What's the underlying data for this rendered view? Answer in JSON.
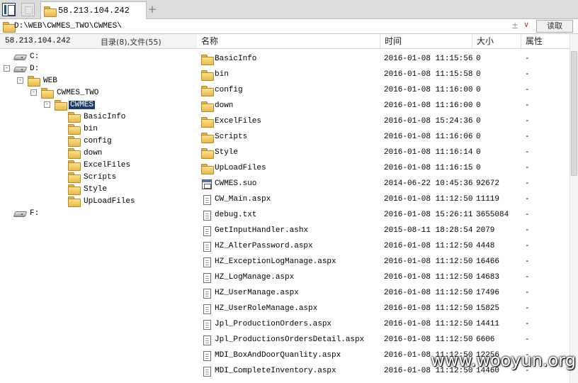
{
  "tab": {
    "title": "58.213.104.242",
    "add_label": "+"
  },
  "address": {
    "path": "D:\\WEB\\CWMES_TWO\\CWMES\\",
    "plus": "±",
    "dropdown": "∨",
    "read_button": "读取"
  },
  "left_header": {
    "host": "58.213.104.242",
    "summary": "目录(8),文件(55)"
  },
  "tree": {
    "drive_c": "C:",
    "drive_d": "D:",
    "web": "WEB",
    "cwmes_two": "CWMES_TWO",
    "cwmes": "CWMES",
    "children": [
      "BasicInfo",
      "bin",
      "config",
      "down",
      "ExcelFiles",
      "Scripts",
      "Style",
      "UpLoadFiles"
    ],
    "drive_f": "F:",
    "expander_minus": "-"
  },
  "columns": {
    "name": "名称",
    "time": "时间",
    "size": "大小",
    "attr": "属性"
  },
  "files": [
    {
      "icon": "folder-icon",
      "name": "BasicInfo",
      "time": "2016-01-08 11:15:56",
      "size": "0",
      "attr": "-"
    },
    {
      "icon": "folder-icon",
      "name": "bin",
      "time": "2016-01-08 11:15:58",
      "size": "0",
      "attr": "-"
    },
    {
      "icon": "folder-icon",
      "name": "config",
      "time": "2016-01-08 11:16:00",
      "size": "0",
      "attr": "-"
    },
    {
      "icon": "folder-icon",
      "name": "down",
      "time": "2016-01-08 11:16:00",
      "size": "0",
      "attr": "-"
    },
    {
      "icon": "folder-icon",
      "name": "ExcelFiles",
      "time": "2016-01-08 15:24:36",
      "size": "0",
      "attr": "-"
    },
    {
      "icon": "folder-icon",
      "name": "Scripts",
      "time": "2016-01-08 11:16:06",
      "size": "0",
      "attr": "-"
    },
    {
      "icon": "folder-icon",
      "name": "Style",
      "time": "2016-01-08 11:16:14",
      "size": "0",
      "attr": "-"
    },
    {
      "icon": "folder-icon",
      "name": "UpLoadFiles",
      "time": "2016-01-08 11:16:15",
      "size": "0",
      "attr": "-"
    },
    {
      "icon": "suo-file-icon",
      "name": "CWMES.suo",
      "time": "2014-06-22 10:45:36",
      "size": "92672",
      "attr": "-"
    },
    {
      "icon": "file-icon",
      "name": "CW_Main.aspx",
      "time": "2016-01-08 11:12:50",
      "size": "11119",
      "attr": "-"
    },
    {
      "icon": "file-icon",
      "name": "debug.txt",
      "time": "2016-01-08 15:26:11",
      "size": "3655084",
      "attr": "-"
    },
    {
      "icon": "file-icon",
      "name": "GetInputHandler.ashx",
      "time": "2015-08-11 18:28:54",
      "size": "2079",
      "attr": "-"
    },
    {
      "icon": "file-icon",
      "name": "HZ_AlterPassword.aspx",
      "time": "2016-01-08 11:12:50",
      "size": "4448",
      "attr": "-"
    },
    {
      "icon": "file-icon",
      "name": "HZ_ExceptionLogManage.aspx",
      "time": "2016-01-08 11:12:50",
      "size": "16466",
      "attr": "-"
    },
    {
      "icon": "file-icon",
      "name": "HZ_LogManage.aspx",
      "time": "2016-01-08 11:12:50",
      "size": "14683",
      "attr": "-"
    },
    {
      "icon": "file-icon",
      "name": "HZ_UserManage.aspx",
      "time": "2016-01-08 11:12:50",
      "size": "17496",
      "attr": "-"
    },
    {
      "icon": "file-icon",
      "name": "HZ_UserRoleManage.aspx",
      "time": "2016-01-08 11:12:50",
      "size": "15825",
      "attr": "-"
    },
    {
      "icon": "file-icon",
      "name": "Jpl_ProductionOrders.aspx",
      "time": "2016-01-08 11:12:50",
      "size": "14411",
      "attr": "-"
    },
    {
      "icon": "file-icon",
      "name": "Jpl_ProductionsOrdersDetail.aspx",
      "time": "2016-01-08 11:12:50",
      "size": "6606",
      "attr": "-"
    },
    {
      "icon": "file-icon",
      "name": "MDI_BoxAndDoorQuanlity.aspx",
      "time": "2016-01-08 11:12:50",
      "size": "12256",
      "attr": "-"
    },
    {
      "icon": "file-icon",
      "name": "MDI_CompleteInventory.aspx",
      "time": "2016-01-08 11:12:50",
      "size": "14460",
      "attr": "-"
    }
  ],
  "watermark": "www.wooyun.org"
}
